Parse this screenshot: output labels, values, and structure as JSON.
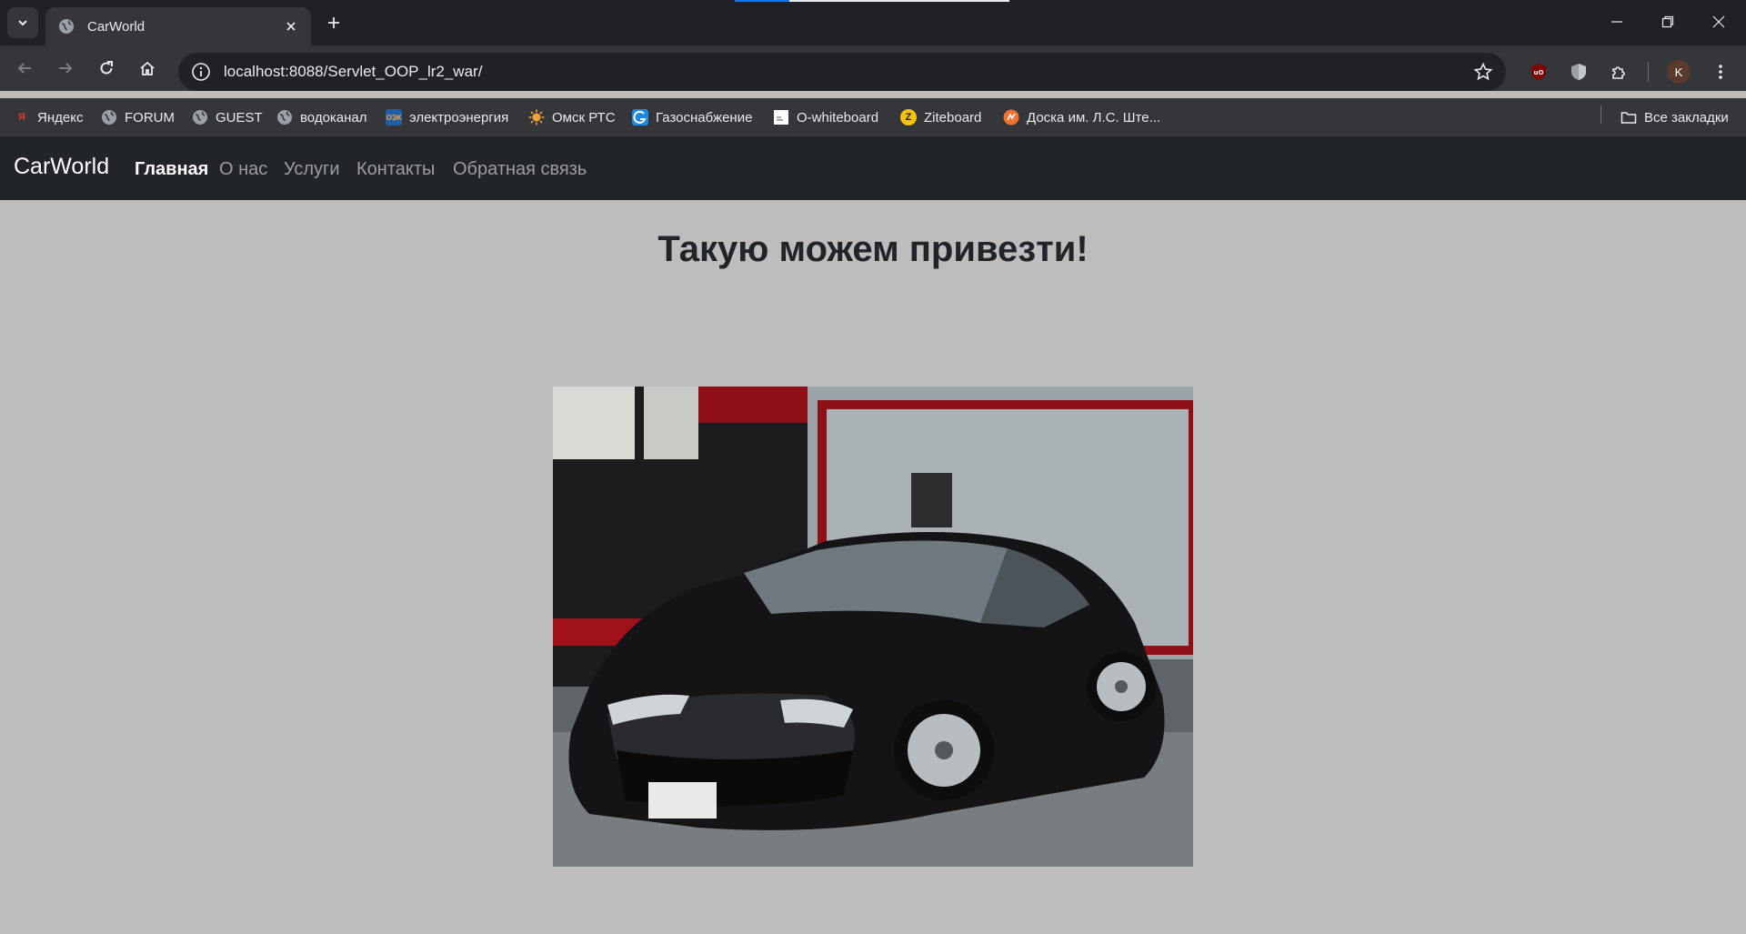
{
  "browser": {
    "tab_title": "CarWorld",
    "url": "localhost:8088/Servlet_OOP_lr2_war/",
    "profile_initial": "K",
    "bookmarks": [
      {
        "label": "Яндекс",
        "icon": "yandex-icon",
        "color": "#e03a2f"
      },
      {
        "label": "FORUM",
        "icon": "globe-icon",
        "color": "#9aa0a6"
      },
      {
        "label": "GUEST",
        "icon": "globe-icon",
        "color": "#9aa0a6"
      },
      {
        "label": "водоканал",
        "icon": "globe-icon",
        "color": "#9aa0a6"
      },
      {
        "label": "электроэнергия",
        "icon": "power-company-icon",
        "color": "#1f5fa8"
      },
      {
        "label": "Омск РТС",
        "icon": "sun-icon",
        "color": "#f2a23a"
      },
      {
        "label": "Газоснабжение",
        "icon": "gas-company-icon",
        "color": "#1e88e5"
      },
      {
        "label": "O-whiteboard",
        "icon": "document-icon",
        "color": "#ffffff"
      },
      {
        "label": "Ziteboard",
        "icon": "ziteboard-icon",
        "color": "#f4c20d"
      },
      {
        "label": "Доска им. Л.С. Ште...",
        "icon": "board-icon",
        "color": "#f0722e"
      }
    ],
    "all_bookmarks_label": "Все закладки"
  },
  "page": {
    "brand": "CarWorld",
    "nav": [
      {
        "label": "Главная",
        "active": true
      },
      {
        "label": "О нас",
        "active": false
      },
      {
        "label": "Услуги",
        "active": false
      },
      {
        "label": "Контакты",
        "active": false
      },
      {
        "label": "Обратная связь",
        "active": false
      }
    ],
    "heading": "Такую можем привезти!",
    "image_subject": "black sedan car photo"
  },
  "colors": {
    "navbar_bg": "#212529",
    "page_bg": "#bdbdbd",
    "chrome_dark": "#202124",
    "chrome_mid": "#35363a"
  }
}
